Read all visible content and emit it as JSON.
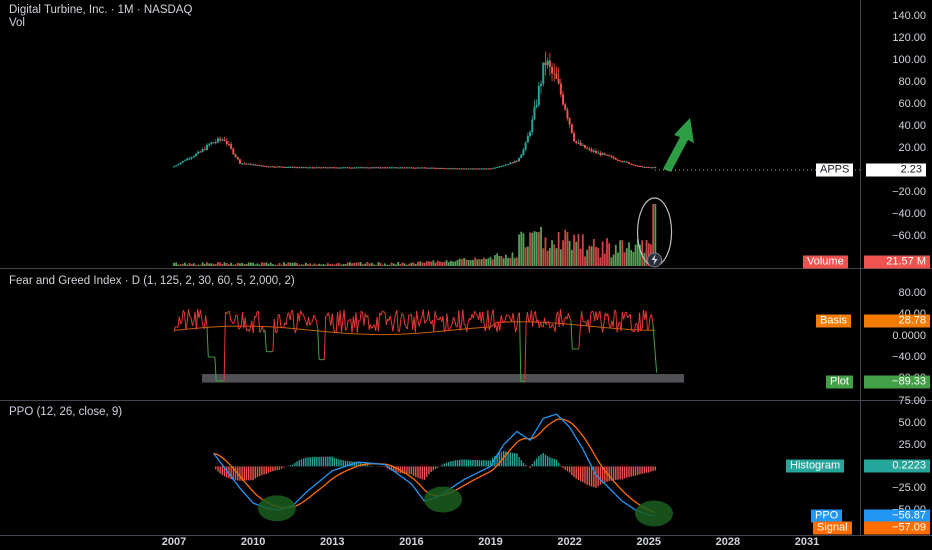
{
  "price_pane": {
    "title": "Digital Turbine, Inc. · 1M · NASDAQ",
    "vol_label": "Vol",
    "ticks": [
      "140.00",
      "120.00",
      "100.00",
      "80.00",
      "60.00",
      "40.00",
      "20.00",
      "0",
      "−20.00",
      "−40.00",
      "−60.00"
    ],
    "symbol_tag": {
      "label": "APPS",
      "value": "2.23"
    },
    "volume_tag": {
      "label": "Volume",
      "value": "21.57 M"
    },
    "colors": {
      "up": "#26a69a",
      "down": "#ef5350",
      "vol_up": "#66bb6a",
      "vol_down": "#ef5350",
      "arrow": "#2e9e44"
    }
  },
  "fgi_pane": {
    "title": "Fear and Greed Index · D (1, 125, 2, 30, 60, 5, 2,000, 2)",
    "ticks": [
      "80.00",
      "40.00",
      "0.0000",
      "−40.00",
      "−80.00"
    ],
    "basis_tag": {
      "label": "Basis",
      "value": "28.78"
    },
    "plot_tag": {
      "label": "Plot",
      "value": "−89.33"
    },
    "colors": {
      "basis": "#f57c00",
      "plot_high": "#e53935",
      "plot_low": "#43a047"
    }
  },
  "ppo_pane": {
    "title": "PPO (12, 26, close, 9)",
    "ticks": [
      "75.00",
      "50.00",
      "25.00",
      "0.0000",
      "−25.00",
      "−50.00"
    ],
    "hist_tag": {
      "label": "Histogram",
      "value": "0.2223"
    },
    "ppo_tag": {
      "label": "PPO",
      "value": "−56.87"
    },
    "signal_tag": {
      "label": "Signal",
      "value": "−57.09"
    },
    "colors": {
      "ppo": "#2196f3",
      "signal": "#ff6d00",
      "hist_pos": "#26a69a",
      "hist_neg": "#ef5350",
      "circle": "#1b5e20"
    }
  },
  "x_axis": [
    "2007",
    "2010",
    "2013",
    "2016",
    "2019",
    "2022",
    "2025",
    "2028",
    "2031"
  ],
  "chart_data": [
    {
      "type": "line",
      "title": "Digital Turbine, Inc. · 1M · NASDAQ",
      "series": [
        {
          "name": "APPS",
          "x": [
            2007.0,
            2007.5,
            2008.0,
            2008.4,
            2008.9,
            2009.5,
            2010.5,
            2012.0,
            2014.0,
            2016.0,
            2018.0,
            2019.0,
            2019.5,
            2020.0,
            2020.3,
            2020.6,
            2020.9,
            2021.1,
            2021.2,
            2021.5,
            2021.8,
            2022.2,
            2022.7,
            2023.2,
            2023.7,
            2024.2,
            2024.6,
            2025.0,
            2025.3
          ],
          "values": [
            3,
            10,
            16,
            24,
            28,
            6,
            3,
            2,
            2,
            2,
            1,
            1,
            4,
            8,
            20,
            45,
            80,
            100,
            92,
            80,
            60,
            25,
            18,
            14,
            10,
            6,
            3,
            2,
            2.23
          ]
        }
      ],
      "ylim": [
        -60,
        140
      ]
    },
    {
      "type": "bar",
      "title": "Vol",
      "series": [
        {
          "name": "Volume",
          "last_value": "21.57 M"
        }
      ]
    },
    {
      "type": "line",
      "title": "Fear and Greed Index · D (1, 125, 2, 30, 60, 5, 2,000, 2)",
      "series": [
        {
          "name": "Basis",
          "last_value": 28.78
        },
        {
          "name": "Plot",
          "last_value": -89.33
        }
      ],
      "ylim": [
        -80,
        80
      ]
    },
    {
      "type": "line",
      "title": "PPO (12, 26, close, 9)",
      "series": [
        {
          "name": "PPO",
          "x": [
            2008.5,
            2009.0,
            2009.5,
            2010.0,
            2010.5,
            2011.0,
            2011.5,
            2012.0,
            2013.0,
            2014.0,
            2015.0,
            2016.0,
            2016.5,
            2017.0,
            2017.5,
            2018.0,
            2019.0,
            2019.5,
            2020.0,
            2020.5,
            2021.0,
            2021.5,
            2022.0,
            2022.5,
            2023.0,
            2023.5,
            2024.0,
            2024.5,
            2025.0,
            2025.3
          ],
          "values": [
            15,
            -5,
            -25,
            -42,
            -48,
            -50,
            -45,
            -30,
            -5,
            5,
            2,
            -20,
            -40,
            -35,
            -25,
            -15,
            0,
            25,
            40,
            30,
            55,
            60,
            45,
            20,
            -10,
            -25,
            -40,
            -50,
            -56,
            -56.87
          ]
        },
        {
          "name": "Signal",
          "last_value": -57.09
        },
        {
          "name": "Histogram",
          "last_value": 0.2223
        }
      ],
      "ylim": [
        -60,
        75
      ]
    }
  ]
}
